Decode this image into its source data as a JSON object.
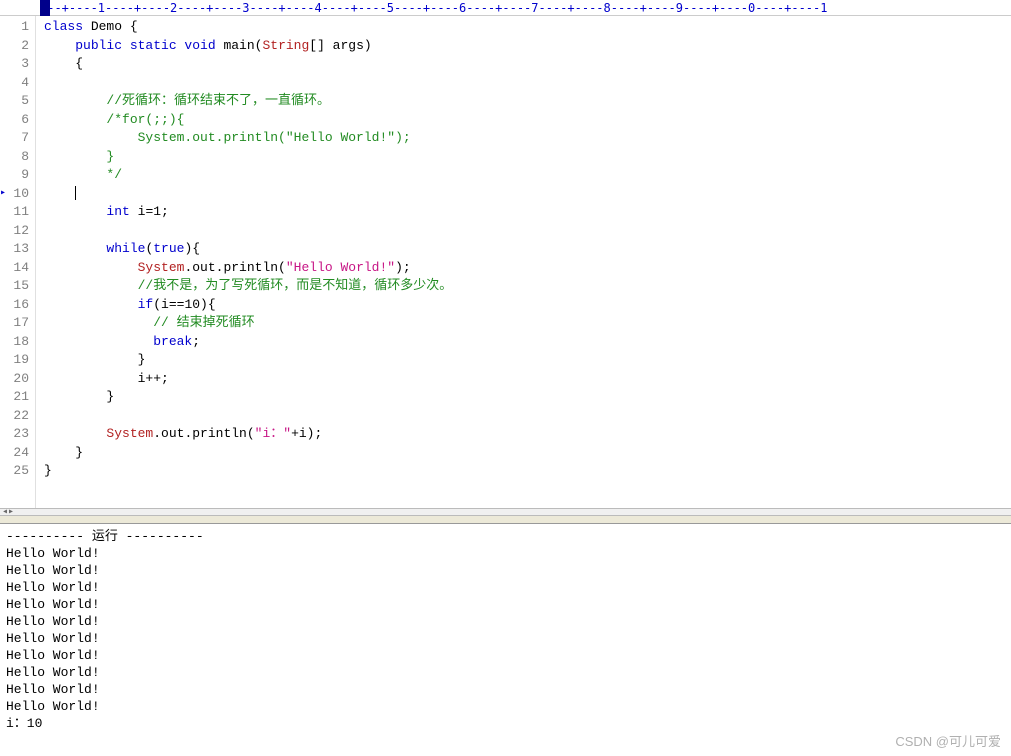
{
  "ruler": "---+----1----+----2----+----3----+----4----+----5----+----6----+----7----+----8----+----9----+----0----+----1",
  "current_line": 10,
  "code": [
    {
      "n": 1,
      "tokens": [
        {
          "t": "class ",
          "c": "kw"
        },
        {
          "t": "Demo {"
        }
      ]
    },
    {
      "n": 2,
      "tokens": [
        {
          "t": "    "
        },
        {
          "t": "public static void ",
          "c": "kw"
        },
        {
          "t": "main("
        },
        {
          "t": "String",
          "c": "cls"
        },
        {
          "t": "[] args)"
        }
      ]
    },
    {
      "n": 3,
      "tokens": [
        {
          "t": "    {"
        }
      ]
    },
    {
      "n": 4,
      "tokens": [
        {
          "t": ""
        }
      ]
    },
    {
      "n": 5,
      "tokens": [
        {
          "t": "        "
        },
        {
          "t": "//死循环：循环结束不了，一直循环。",
          "c": "cmt"
        }
      ]
    },
    {
      "n": 6,
      "tokens": [
        {
          "t": "        "
        },
        {
          "t": "/*for(;;){",
          "c": "cmt"
        }
      ]
    },
    {
      "n": 7,
      "tokens": [
        {
          "t": "            "
        },
        {
          "t": "System.out.println(\"Hello World!\");",
          "c": "cmt"
        }
      ]
    },
    {
      "n": 8,
      "tokens": [
        {
          "t": "        "
        },
        {
          "t": "}",
          "c": "cmt"
        }
      ]
    },
    {
      "n": 9,
      "tokens": [
        {
          "t": "        "
        },
        {
          "t": "*/",
          "c": "cmt"
        }
      ]
    },
    {
      "n": 10,
      "tokens": [
        {
          "t": "    "
        }
      ],
      "cursor": true
    },
    {
      "n": 11,
      "tokens": [
        {
          "t": "        "
        },
        {
          "t": "int ",
          "c": "kw"
        },
        {
          "t": "i=1;"
        }
      ]
    },
    {
      "n": 12,
      "tokens": [
        {
          "t": ""
        }
      ]
    },
    {
      "n": 13,
      "tokens": [
        {
          "t": "        "
        },
        {
          "t": "while",
          "c": "kw"
        },
        {
          "t": "("
        },
        {
          "t": "true",
          "c": "kw"
        },
        {
          "t": "){"
        }
      ]
    },
    {
      "n": 14,
      "tokens": [
        {
          "t": "            "
        },
        {
          "t": "System",
          "c": "cls"
        },
        {
          "t": ".out.println("
        },
        {
          "t": "\"Hello World!\"",
          "c": "str"
        },
        {
          "t": ");"
        }
      ]
    },
    {
      "n": 15,
      "tokens": [
        {
          "t": "            "
        },
        {
          "t": "//我不是，为了写死循环，而是不知道，循环多少次。",
          "c": "cmt"
        }
      ]
    },
    {
      "n": 16,
      "tokens": [
        {
          "t": "            "
        },
        {
          "t": "if",
          "c": "kw"
        },
        {
          "t": "(i==10){"
        }
      ]
    },
    {
      "n": 17,
      "tokens": [
        {
          "t": "              "
        },
        {
          "t": "// 结束掉死循环",
          "c": "cmt"
        }
      ]
    },
    {
      "n": 18,
      "tokens": [
        {
          "t": "              "
        },
        {
          "t": "break",
          "c": "kw"
        },
        {
          "t": ";"
        }
      ]
    },
    {
      "n": 19,
      "tokens": [
        {
          "t": "            }"
        }
      ]
    },
    {
      "n": 20,
      "tokens": [
        {
          "t": "            i++;"
        }
      ]
    },
    {
      "n": 21,
      "tokens": [
        {
          "t": "        }"
        }
      ]
    },
    {
      "n": 22,
      "tokens": [
        {
          "t": ""
        }
      ]
    },
    {
      "n": 23,
      "tokens": [
        {
          "t": "        "
        },
        {
          "t": "System",
          "c": "cls"
        },
        {
          "t": ".out.println("
        },
        {
          "t": "\"i：\"",
          "c": "str"
        },
        {
          "t": "+i);"
        }
      ]
    },
    {
      "n": 24,
      "tokens": [
        {
          "t": "    }"
        }
      ]
    },
    {
      "n": 25,
      "tokens": [
        {
          "t": "}"
        }
      ]
    }
  ],
  "console": {
    "header": "---------- 运行 ----------",
    "lines": [
      "Hello World!",
      "Hello World!",
      "Hello World!",
      "Hello World!",
      "Hello World!",
      "Hello World!",
      "Hello World!",
      "Hello World!",
      "Hello World!",
      "Hello World!",
      "i：10"
    ]
  },
  "watermark": "CSDN @可儿可爱"
}
